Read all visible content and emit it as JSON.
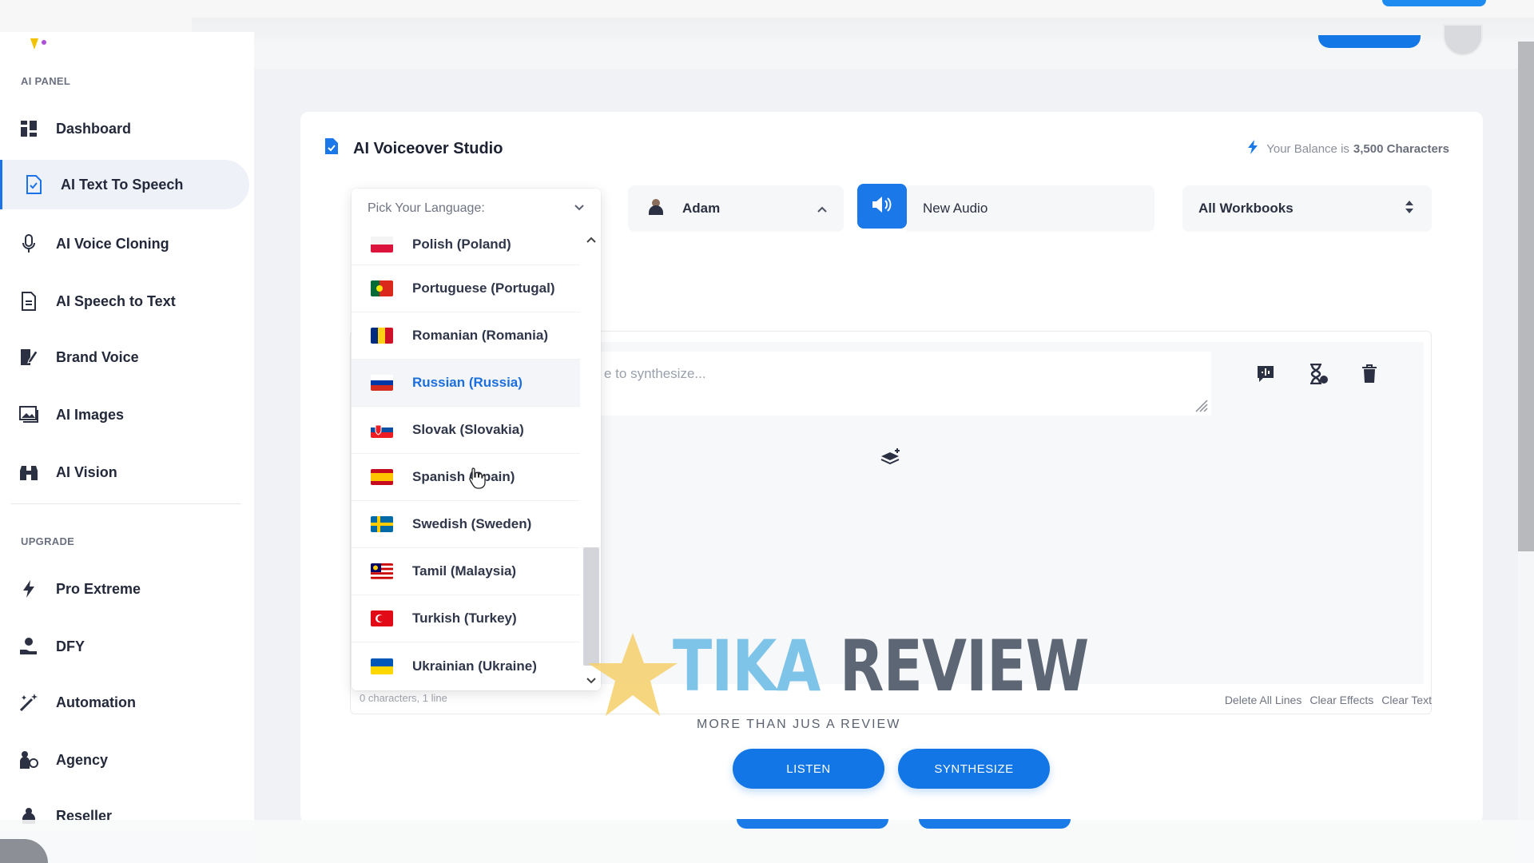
{
  "sidebar": {
    "section_ai": "AI PANEL",
    "section_upgrade": "UPGRADE",
    "items": [
      {
        "label": "Dashboard",
        "icon": "dashboard-icon"
      },
      {
        "label": "AI Text To Speech",
        "icon": "document-speech-icon",
        "active": true
      },
      {
        "label": "AI Voice Cloning",
        "icon": "microphone-icon"
      },
      {
        "label": "AI Speech to Text",
        "icon": "document-text-icon"
      },
      {
        "label": "Brand Voice",
        "icon": "pen-document-icon"
      },
      {
        "label": "AI Images",
        "icon": "images-icon"
      },
      {
        "label": "AI Vision",
        "icon": "binoculars-icon"
      }
    ],
    "upgrade_items": [
      {
        "label": "Pro Extreme",
        "icon": "bolt-icon"
      },
      {
        "label": "DFY",
        "icon": "hand-user-icon"
      },
      {
        "label": "Automation",
        "icon": "magic-wand-icon"
      },
      {
        "label": "Agency",
        "icon": "agency-icon"
      },
      {
        "label": "Reseller",
        "icon": "reseller-icon"
      }
    ]
  },
  "studio": {
    "title": "AI Voiceover Studio",
    "balance_prefix": "Your Balance is",
    "balance_value": "3,500 Characters"
  },
  "controls": {
    "voice_name": "Adam",
    "audio_name": "New Audio",
    "workbooks": "All Workbooks"
  },
  "language_dropdown": {
    "placeholder": "Pick Your Language:",
    "items": [
      {
        "label": "Polish (Poland)",
        "flag": "pl"
      },
      {
        "label": "Portuguese (Portugal)",
        "flag": "pt"
      },
      {
        "label": "Romanian (Romania)",
        "flag": "ro"
      },
      {
        "label": "Russian (Russia)",
        "flag": "ru",
        "selected": true
      },
      {
        "label": "Slovak (Slovakia)",
        "flag": "sk"
      },
      {
        "label": "Spanish (Spain)",
        "flag": "es"
      },
      {
        "label": "Swedish (Sweden)",
        "flag": "se"
      },
      {
        "label": "Tamil (Malaysia)",
        "flag": "my"
      },
      {
        "label": "Turkish (Turkey)",
        "flag": "tr"
      },
      {
        "label": "Ukrainian (Ukraine)",
        "flag": "ua"
      }
    ]
  },
  "editor": {
    "placeholder": "e to synthesize...",
    "char_count": "0 characters, 1 line",
    "links": [
      "Delete All Lines",
      "Clear Effects",
      "Clear Text"
    ]
  },
  "actions": {
    "listen": "LISTEN",
    "synthesize": "SYNTHESIZE"
  },
  "watermark": {
    "brand_a": "TIKA",
    "brand_b": "REVIEW",
    "tagline": "MORE THAN JUS A REVIEW"
  },
  "colors": {
    "accent": "#1a78e8",
    "selected_text": "#1a6fdd",
    "watermark_blue": "#7ec4e8",
    "watermark_star": "#f6cf6a"
  }
}
